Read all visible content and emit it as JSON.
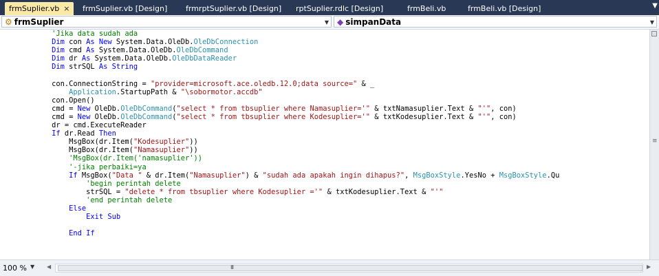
{
  "tabs": [
    {
      "label": "frmSuplier.vb",
      "active": true
    },
    {
      "label": "frmSuplier.vb [Design]",
      "active": false
    },
    {
      "label": "frmrptSuplier.vb [Design]",
      "active": false
    },
    {
      "label": "rptSuplier.rdlc [Design]",
      "active": false
    },
    {
      "label": "frmBeli.vb",
      "active": false
    },
    {
      "label": "frmBeli.vb [Design]",
      "active": false
    }
  ],
  "tab_close_glyph": "×",
  "navigation": {
    "class_combo": "frmSuplier",
    "method_combo": "simpanData"
  },
  "code_lines": [
    [
      {
        "c": "cm",
        "t": "            'Jika data sudah ada"
      }
    ],
    [
      {
        "c": "kw",
        "t": "            Dim"
      },
      {
        "c": "tx",
        "t": " con "
      },
      {
        "c": "kw",
        "t": "As New"
      },
      {
        "c": "tx",
        "t": " System.Data.OleDb."
      },
      {
        "c": "ty",
        "t": "OleDbConnection"
      }
    ],
    [
      {
        "c": "kw",
        "t": "            Dim"
      },
      {
        "c": "tx",
        "t": " cmd "
      },
      {
        "c": "kw",
        "t": "As"
      },
      {
        "c": "tx",
        "t": " System.Data.OleDb."
      },
      {
        "c": "ty",
        "t": "OleDbCommand"
      }
    ],
    [
      {
        "c": "kw",
        "t": "            Dim"
      },
      {
        "c": "tx",
        "t": " dr "
      },
      {
        "c": "kw",
        "t": "As"
      },
      {
        "c": "tx",
        "t": " System.Data.OleDb."
      },
      {
        "c": "ty",
        "t": "OleDbDataReader"
      }
    ],
    [
      {
        "c": "kw",
        "t": "            Dim"
      },
      {
        "c": "tx",
        "t": " strSQL "
      },
      {
        "c": "kw",
        "t": "As String"
      }
    ],
    [
      {
        "c": "tx",
        "t": ""
      }
    ],
    [
      {
        "c": "tx",
        "t": "            con.ConnectionString = "
      },
      {
        "c": "st",
        "t": "\"provider=microsoft.ace.oledb.12.0;data source=\""
      },
      {
        "c": "tx",
        "t": " & _"
      }
    ],
    [
      {
        "c": "tx",
        "t": "                "
      },
      {
        "c": "ty",
        "t": "Application"
      },
      {
        "c": "tx",
        "t": ".StartupPath & "
      },
      {
        "c": "st",
        "t": "\"\\sobormotor.accdb\""
      }
    ],
    [
      {
        "c": "tx",
        "t": "            con.Open()"
      }
    ],
    [
      {
        "c": "tx",
        "t": "            cmd = "
      },
      {
        "c": "kw",
        "t": "New"
      },
      {
        "c": "tx",
        "t": " OleDb."
      },
      {
        "c": "ty",
        "t": "OleDbCommand"
      },
      {
        "c": "tx",
        "t": "("
      },
      {
        "c": "st",
        "t": "\"select * from tbsuplier where Namasuplier='\""
      },
      {
        "c": "tx",
        "t": " & txtNamasuplier.Text & "
      },
      {
        "c": "st",
        "t": "\"'\""
      },
      {
        "c": "tx",
        "t": ", con)"
      }
    ],
    [
      {
        "c": "tx",
        "t": "            cmd = "
      },
      {
        "c": "kw",
        "t": "New"
      },
      {
        "c": "tx",
        "t": " OleDb."
      },
      {
        "c": "ty",
        "t": "OleDbCommand"
      },
      {
        "c": "tx",
        "t": "("
      },
      {
        "c": "st",
        "t": "\"select * from tbsuplier where Kodesuplier='\""
      },
      {
        "c": "tx",
        "t": " & txtKodesuplier.Text & "
      },
      {
        "c": "st",
        "t": "\"'\""
      },
      {
        "c": "tx",
        "t": ", con)"
      }
    ],
    [
      {
        "c": "tx",
        "t": "            dr = cmd.ExecuteReader"
      }
    ],
    [
      {
        "c": "kw",
        "t": "            If"
      },
      {
        "c": "tx",
        "t": " dr.Read "
      },
      {
        "c": "kw",
        "t": "Then"
      }
    ],
    [
      {
        "c": "tx",
        "t": "                MsgBox(dr.Item("
      },
      {
        "c": "st",
        "t": "\"Kodesuplier\""
      },
      {
        "c": "tx",
        "t": "))"
      }
    ],
    [
      {
        "c": "tx",
        "t": "                MsgBox(dr.Item("
      },
      {
        "c": "st",
        "t": "\"Namasuplier\""
      },
      {
        "c": "tx",
        "t": "))"
      }
    ],
    [
      {
        "c": "cm",
        "t": "                'MsgBox(dr.Item('namasuplier'))"
      }
    ],
    [
      {
        "c": "cm",
        "t": "                '-jika perbaiki=ya"
      }
    ],
    [
      {
        "c": "kw",
        "t": "                If"
      },
      {
        "c": "tx",
        "t": " MsgBox("
      },
      {
        "c": "st",
        "t": "\"Data \""
      },
      {
        "c": "tx",
        "t": " & dr.Item("
      },
      {
        "c": "st",
        "t": "\"Namasuplier\""
      },
      {
        "c": "tx",
        "t": ") & "
      },
      {
        "c": "st",
        "t": "\"sudah ada apakah ingin dihapus?\""
      },
      {
        "c": "tx",
        "t": ", "
      },
      {
        "c": "ty",
        "t": "MsgBoxStyle"
      },
      {
        "c": "tx",
        "t": ".YesNo + "
      },
      {
        "c": "ty",
        "t": "MsgBoxStyle"
      },
      {
        "c": "tx",
        "t": ".Qu"
      }
    ],
    [
      {
        "c": "cm",
        "t": "                    'begin perintah delete"
      }
    ],
    [
      {
        "c": "tx",
        "t": "                    strSQL = "
      },
      {
        "c": "st",
        "t": "\"delete * from tbsuplier where Kodesuplier ='\""
      },
      {
        "c": "tx",
        "t": " & txtKodesuplier.Text & "
      },
      {
        "c": "st",
        "t": "\"'\""
      }
    ],
    [
      {
        "c": "cm",
        "t": "                    'end perintah delete"
      }
    ],
    [
      {
        "c": "kw",
        "t": "                Else"
      }
    ],
    [
      {
        "c": "kw",
        "t": "                    Exit Sub"
      }
    ],
    [
      {
        "c": "tx",
        "t": ""
      }
    ],
    [
      {
        "c": "kw",
        "t": "                End If"
      }
    ]
  ],
  "colors": {
    "kw": "#0000ff",
    "tx": "#000000",
    "st": "#a31515",
    "cm": "#008000",
    "ty": "#2b91af"
  },
  "status": {
    "zoom": "100 %"
  }
}
